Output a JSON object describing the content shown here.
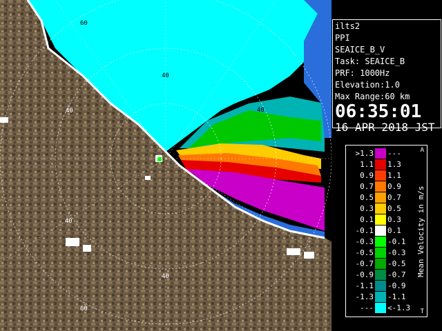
{
  "info": {
    "station": "ilts2",
    "mode": "PPI",
    "product": "SEAICE_B_V",
    "task": "Task: SEAICE_B",
    "prf": "PRF: 1000Hz",
    "elevation": "Elevation:1.0",
    "max_range": "Max Range:60 km",
    "time": "06:35:01",
    "date": "16 APR 2018 JST"
  },
  "legend": {
    "title": "Mean Velocity in m/s",
    "top_corner": "A",
    "bottom_corner": "T",
    "rows": [
      {
        "lo": ">1.3",
        "hi": "---",
        "color": "#c800c8"
      },
      {
        "lo": "1.1",
        "hi": "1.3",
        "color": "#e60000"
      },
      {
        "lo": "0.9",
        "hi": "1.1",
        "color": "#ff3c00"
      },
      {
        "lo": "0.7",
        "hi": "0.9",
        "color": "#ff7800"
      },
      {
        "lo": "0.5",
        "hi": "0.7",
        "color": "#ffa000"
      },
      {
        "lo": "0.3",
        "hi": "0.5",
        "color": "#ffcc00"
      },
      {
        "lo": "0.1",
        "hi": "0.3",
        "color": "#ffff00"
      },
      {
        "lo": "-0.1",
        "hi": "0.1",
        "color": "#ffffff"
      },
      {
        "lo": "-0.3",
        "hi": "-0.1",
        "color": "#00ff00"
      },
      {
        "lo": "-0.5",
        "hi": "-0.3",
        "color": "#00d200"
      },
      {
        "lo": "-0.7",
        "hi": "-0.5",
        "color": "#00aa00"
      },
      {
        "lo": "-0.9",
        "hi": "-0.7",
        "color": "#008c46"
      },
      {
        "lo": "-1.1",
        "hi": "-0.9",
        "color": "#008c8c"
      },
      {
        "lo": "-1.3",
        "hi": "-1.1",
        "color": "#00b4b4"
      },
      {
        "lo": "---",
        "hi": "<-1.3",
        "color": "#00ffff"
      }
    ]
  },
  "range_labels": [
    "60",
    "40",
    "40",
    "40",
    "40",
    "40",
    "60"
  ],
  "colors": {
    "land": "#6b5a44",
    "land_light": "#9a8564",
    "sea": "#2a6edc",
    "ice_cyan": "#00ffff",
    "coast": "#ffffff"
  }
}
